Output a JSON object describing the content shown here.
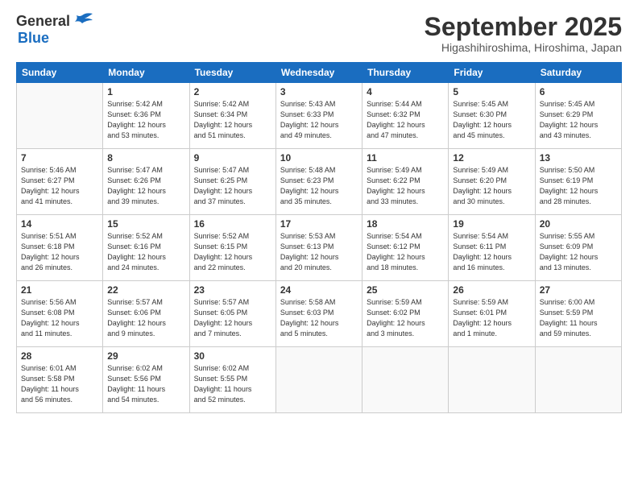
{
  "header": {
    "logo_general": "General",
    "logo_blue": "Blue",
    "month_title": "September 2025",
    "location": "Higashihiroshima, Hiroshima, Japan"
  },
  "days_of_week": [
    "Sunday",
    "Monday",
    "Tuesday",
    "Wednesday",
    "Thursday",
    "Friday",
    "Saturday"
  ],
  "weeks": [
    [
      {
        "num": "",
        "info": ""
      },
      {
        "num": "1",
        "info": "Sunrise: 5:42 AM\nSunset: 6:36 PM\nDaylight: 12 hours\nand 53 minutes."
      },
      {
        "num": "2",
        "info": "Sunrise: 5:42 AM\nSunset: 6:34 PM\nDaylight: 12 hours\nand 51 minutes."
      },
      {
        "num": "3",
        "info": "Sunrise: 5:43 AM\nSunset: 6:33 PM\nDaylight: 12 hours\nand 49 minutes."
      },
      {
        "num": "4",
        "info": "Sunrise: 5:44 AM\nSunset: 6:32 PM\nDaylight: 12 hours\nand 47 minutes."
      },
      {
        "num": "5",
        "info": "Sunrise: 5:45 AM\nSunset: 6:30 PM\nDaylight: 12 hours\nand 45 minutes."
      },
      {
        "num": "6",
        "info": "Sunrise: 5:45 AM\nSunset: 6:29 PM\nDaylight: 12 hours\nand 43 minutes."
      }
    ],
    [
      {
        "num": "7",
        "info": "Sunrise: 5:46 AM\nSunset: 6:27 PM\nDaylight: 12 hours\nand 41 minutes."
      },
      {
        "num": "8",
        "info": "Sunrise: 5:47 AM\nSunset: 6:26 PM\nDaylight: 12 hours\nand 39 minutes."
      },
      {
        "num": "9",
        "info": "Sunrise: 5:47 AM\nSunset: 6:25 PM\nDaylight: 12 hours\nand 37 minutes."
      },
      {
        "num": "10",
        "info": "Sunrise: 5:48 AM\nSunset: 6:23 PM\nDaylight: 12 hours\nand 35 minutes."
      },
      {
        "num": "11",
        "info": "Sunrise: 5:49 AM\nSunset: 6:22 PM\nDaylight: 12 hours\nand 33 minutes."
      },
      {
        "num": "12",
        "info": "Sunrise: 5:49 AM\nSunset: 6:20 PM\nDaylight: 12 hours\nand 30 minutes."
      },
      {
        "num": "13",
        "info": "Sunrise: 5:50 AM\nSunset: 6:19 PM\nDaylight: 12 hours\nand 28 minutes."
      }
    ],
    [
      {
        "num": "14",
        "info": "Sunrise: 5:51 AM\nSunset: 6:18 PM\nDaylight: 12 hours\nand 26 minutes."
      },
      {
        "num": "15",
        "info": "Sunrise: 5:52 AM\nSunset: 6:16 PM\nDaylight: 12 hours\nand 24 minutes."
      },
      {
        "num": "16",
        "info": "Sunrise: 5:52 AM\nSunset: 6:15 PM\nDaylight: 12 hours\nand 22 minutes."
      },
      {
        "num": "17",
        "info": "Sunrise: 5:53 AM\nSunset: 6:13 PM\nDaylight: 12 hours\nand 20 minutes."
      },
      {
        "num": "18",
        "info": "Sunrise: 5:54 AM\nSunset: 6:12 PM\nDaylight: 12 hours\nand 18 minutes."
      },
      {
        "num": "19",
        "info": "Sunrise: 5:54 AM\nSunset: 6:11 PM\nDaylight: 12 hours\nand 16 minutes."
      },
      {
        "num": "20",
        "info": "Sunrise: 5:55 AM\nSunset: 6:09 PM\nDaylight: 12 hours\nand 13 minutes."
      }
    ],
    [
      {
        "num": "21",
        "info": "Sunrise: 5:56 AM\nSunset: 6:08 PM\nDaylight: 12 hours\nand 11 minutes."
      },
      {
        "num": "22",
        "info": "Sunrise: 5:57 AM\nSunset: 6:06 PM\nDaylight: 12 hours\nand 9 minutes."
      },
      {
        "num": "23",
        "info": "Sunrise: 5:57 AM\nSunset: 6:05 PM\nDaylight: 12 hours\nand 7 minutes."
      },
      {
        "num": "24",
        "info": "Sunrise: 5:58 AM\nSunset: 6:03 PM\nDaylight: 12 hours\nand 5 minutes."
      },
      {
        "num": "25",
        "info": "Sunrise: 5:59 AM\nSunset: 6:02 PM\nDaylight: 12 hours\nand 3 minutes."
      },
      {
        "num": "26",
        "info": "Sunrise: 5:59 AM\nSunset: 6:01 PM\nDaylight: 12 hours\nand 1 minute."
      },
      {
        "num": "27",
        "info": "Sunrise: 6:00 AM\nSunset: 5:59 PM\nDaylight: 11 hours\nand 59 minutes."
      }
    ],
    [
      {
        "num": "28",
        "info": "Sunrise: 6:01 AM\nSunset: 5:58 PM\nDaylight: 11 hours\nand 56 minutes."
      },
      {
        "num": "29",
        "info": "Sunrise: 6:02 AM\nSunset: 5:56 PM\nDaylight: 11 hours\nand 54 minutes."
      },
      {
        "num": "30",
        "info": "Sunrise: 6:02 AM\nSunset: 5:55 PM\nDaylight: 11 hours\nand 52 minutes."
      },
      {
        "num": "",
        "info": ""
      },
      {
        "num": "",
        "info": ""
      },
      {
        "num": "",
        "info": ""
      },
      {
        "num": "",
        "info": ""
      }
    ]
  ]
}
